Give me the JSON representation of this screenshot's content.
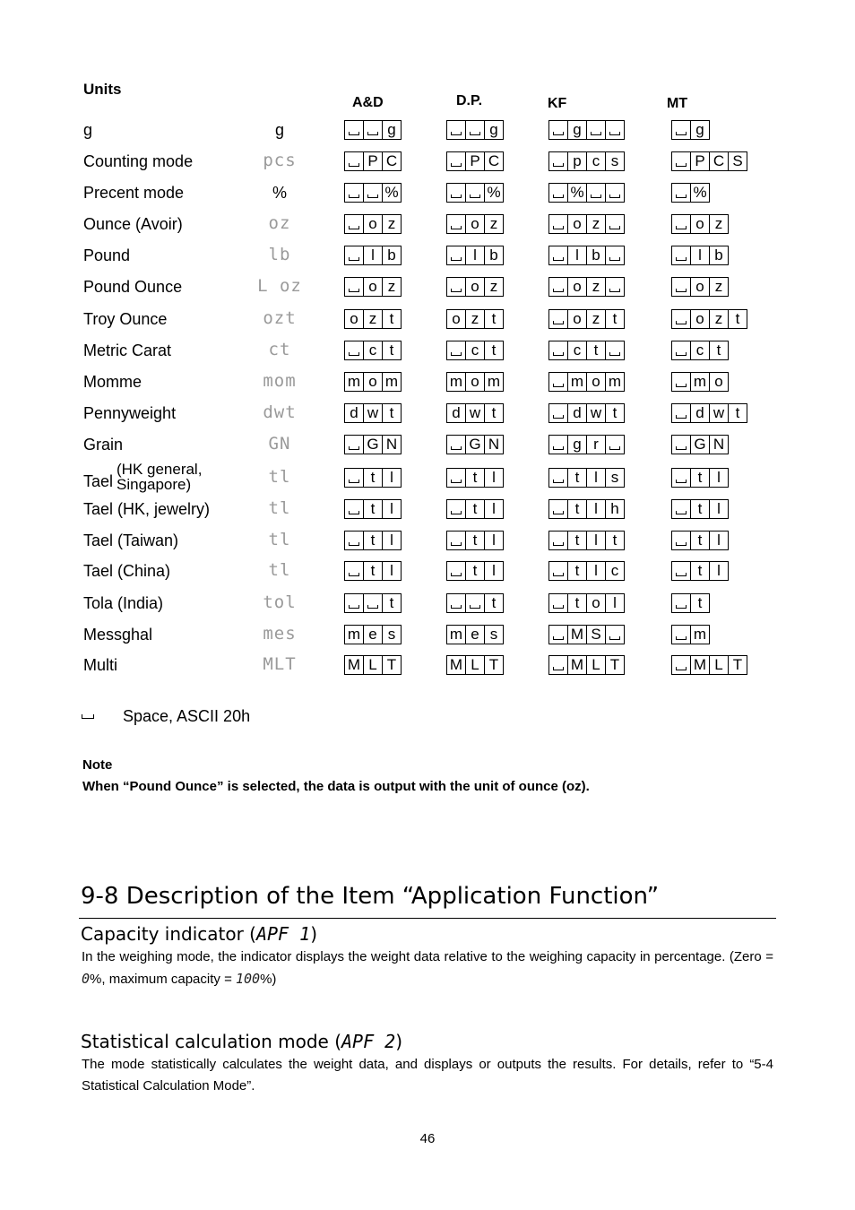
{
  "units_title": "Units",
  "columns": [
    "A&D",
    "D.P.",
    "KF",
    "MT"
  ],
  "rows": [
    {
      "label": "g",
      "display": "g",
      "display_plain": true,
      "ad": [
        " ",
        " ",
        "g"
      ],
      "dp": [
        " ",
        " ",
        "g"
      ],
      "kf": [
        " ",
        "g",
        " ",
        " "
      ],
      "mt": [
        " ",
        "g"
      ]
    },
    {
      "label": "Counting mode",
      "display": "pcs",
      "ad": [
        " ",
        "P",
        "C"
      ],
      "dp": [
        " ",
        "P",
        "C"
      ],
      "kf": [
        " ",
        "p",
        "c",
        "s"
      ],
      "mt": [
        " ",
        "P",
        "C",
        "S"
      ]
    },
    {
      "label": "Precent mode",
      "display": "%",
      "display_plain": true,
      "ad": [
        " ",
        " ",
        "%"
      ],
      "dp": [
        " ",
        " ",
        "%"
      ],
      "kf": [
        " ",
        "%",
        " ",
        " "
      ],
      "mt": [
        " ",
        "%"
      ]
    },
    {
      "label": "Ounce (Avoir)",
      "display": "oz",
      "ad": [
        " ",
        "o",
        "z"
      ],
      "dp": [
        " ",
        "o",
        "z"
      ],
      "kf": [
        " ",
        "o",
        "z",
        " "
      ],
      "mt": [
        " ",
        "o",
        "z"
      ]
    },
    {
      "label": "Pound",
      "display": "lb",
      "ad": [
        " ",
        "l",
        "b"
      ],
      "dp": [
        " ",
        "l",
        "b"
      ],
      "kf": [
        " ",
        "l",
        "b",
        " "
      ],
      "mt": [
        " ",
        "l",
        "b"
      ]
    },
    {
      "label": "Pound Ounce",
      "display": "L oz",
      "ad": [
        " ",
        "o",
        "z"
      ],
      "dp": [
        " ",
        "o",
        "z"
      ],
      "kf": [
        " ",
        "o",
        "z",
        " "
      ],
      "mt": [
        " ",
        "o",
        "z"
      ]
    },
    {
      "label": "Troy Ounce",
      "display": "ozt",
      "ad": [
        "o",
        "z",
        "t"
      ],
      "dp": [
        "o",
        "z",
        "t"
      ],
      "kf": [
        " ",
        "o",
        "z",
        "t"
      ],
      "mt": [
        " ",
        "o",
        "z",
        "t"
      ]
    },
    {
      "label": "Metric Carat",
      "display": "ct",
      "ad": [
        " ",
        "c",
        "t"
      ],
      "dp": [
        " ",
        "c",
        "t"
      ],
      "kf": [
        " ",
        "c",
        "t",
        " "
      ],
      "mt": [
        " ",
        "c",
        "t"
      ]
    },
    {
      "label": "Momme",
      "display": "mom",
      "ad": [
        "m",
        "o",
        "m"
      ],
      "dp": [
        "m",
        "o",
        "m"
      ],
      "kf": [
        " ",
        "m",
        "o",
        "m"
      ],
      "mt": [
        " ",
        "m",
        "o"
      ]
    },
    {
      "label": "Pennyweight",
      "display": "dwt",
      "ad": [
        "d",
        "w",
        "t"
      ],
      "dp": [
        "d",
        "w",
        "t"
      ],
      "kf": [
        " ",
        "d",
        "w",
        "t"
      ],
      "mt": [
        " ",
        "d",
        "w",
        "t"
      ]
    },
    {
      "label": "Grain",
      "display": "GN",
      "ad": [
        " ",
        "G",
        "N"
      ],
      "dp": [
        " ",
        "G",
        "N"
      ],
      "kf": [
        " ",
        "g",
        "r",
        " "
      ],
      "mt": [
        " ",
        "G",
        "N"
      ]
    },
    {
      "label": "Tael",
      "label_sub": "(HK general,\nSingapore)",
      "display": "tl",
      "ad": [
        " ",
        "t",
        "l"
      ],
      "dp": [
        " ",
        "t",
        "l"
      ],
      "kf": [
        " ",
        "t",
        "l",
        "s"
      ],
      "mt": [
        " ",
        "t",
        "l"
      ]
    },
    {
      "label": "Tael (HK, jewelry)",
      "display": "tl",
      "ad": [
        " ",
        "t",
        "l"
      ],
      "dp": [
        " ",
        "t",
        "l"
      ],
      "kf": [
        " ",
        "t",
        "l",
        "h"
      ],
      "mt": [
        " ",
        "t",
        "l"
      ]
    },
    {
      "label": "Tael (Taiwan)",
      "display": "tl",
      "ad": [
        " ",
        "t",
        "l"
      ],
      "dp": [
        " ",
        "t",
        "l"
      ],
      "kf": [
        " ",
        "t",
        "l",
        "t"
      ],
      "mt": [
        " ",
        "t",
        "l"
      ]
    },
    {
      "label": "Tael (China)",
      "display": "tl",
      "ad": [
        " ",
        "t",
        "l"
      ],
      "dp": [
        " ",
        "t",
        "l"
      ],
      "kf": [
        " ",
        "t",
        "l",
        "c"
      ],
      "mt": [
        " ",
        "t",
        "l"
      ]
    },
    {
      "label": "Tola (India)",
      "display": "tol",
      "ad": [
        " ",
        " ",
        "t"
      ],
      "dp": [
        " ",
        " ",
        "t"
      ],
      "kf": [
        " ",
        "t",
        "o",
        "l"
      ],
      "mt": [
        " ",
        "t"
      ]
    },
    {
      "label": "Messghal",
      "display": "mes",
      "ad": [
        "m",
        "e",
        "s"
      ],
      "dp": [
        "m",
        "e",
        "s"
      ],
      "kf": [
        " ",
        "M",
        "S",
        " "
      ],
      "mt": [
        " ",
        "m"
      ]
    },
    {
      "label": "Multi",
      "display": "MLT",
      "ad": [
        "M",
        "L",
        "T"
      ],
      "dp": [
        "M",
        "L",
        "T"
      ],
      "kf": [
        " ",
        "M",
        "L",
        "T"
      ],
      "mt": [
        " ",
        "M",
        "L",
        "T"
      ]
    }
  ],
  "legend": {
    "symbol": "space-symbol",
    "text": "Space,  ASCII  20h"
  },
  "note": {
    "title": "Note",
    "text": "When “Pound Ounce” is selected, the data is output with the unit of ounce (oz)."
  },
  "section": {
    "title": "9-8  Description of the Item “Application Function”",
    "subsections": [
      {
        "title": "Capacity indicator (",
        "code": "APF  1",
        "title_end": ")",
        "text_parts": [
          "In the weighing mode, the indicator displays the weight data relative to the weighing capacity in percentage. (Zero = ",
          "0",
          "%, maximum capacity = ",
          "100",
          "%)"
        ]
      },
      {
        "title": "Statistical calculation mode (",
        "code": "APF 2",
        "title_end": ")",
        "text": "The mode statistically calculates the weight data, and displays or outputs the results. For details, refer to “5-4 Statistical Calculation Mode”."
      }
    ]
  },
  "page_number": "46"
}
